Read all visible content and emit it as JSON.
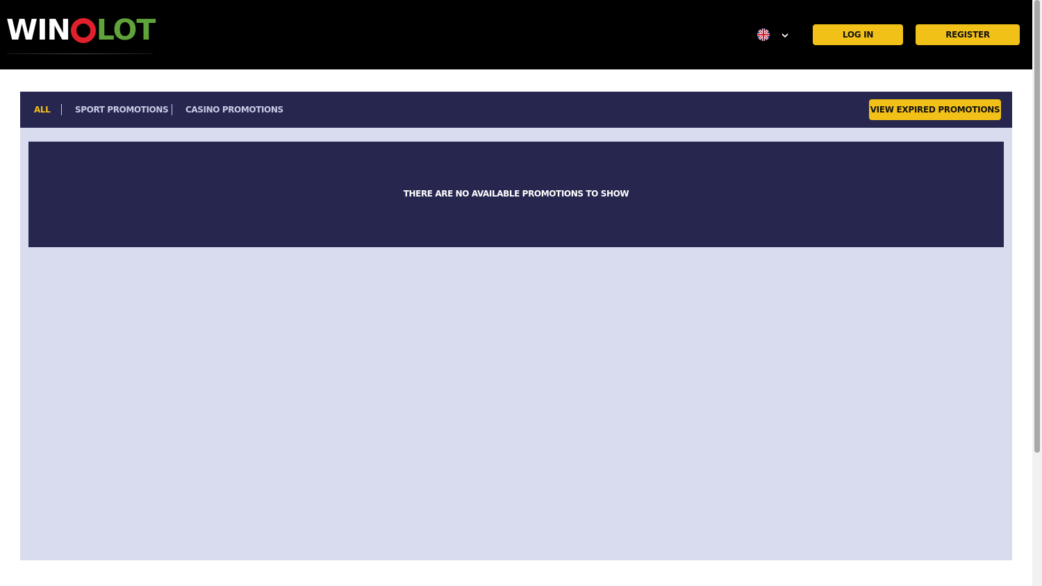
{
  "header": {
    "logo": {
      "part1": "WIN",
      "part2": "LOT"
    },
    "language": {
      "selected": "English",
      "flag_icon": "uk-flag-icon",
      "chevron_icon": "chevron-down-icon"
    },
    "login_label": "LOG IN",
    "register_label": "REGISTER"
  },
  "promotions": {
    "tabs": [
      {
        "label": "ALL",
        "active": true
      },
      {
        "label": "SPORT PROMOTIONS",
        "active": false
      },
      {
        "label": "CASINO PROMOTIONS",
        "active": false
      }
    ],
    "expired_button_label": "VIEW EXPIRED PROMOTIONS",
    "empty_message": "THERE ARE NO AVAILABLE PROMOTIONS TO SHOW"
  },
  "colors": {
    "header_bg": "#000000",
    "accent_yellow": "#f2c118",
    "panel_navy": "#26264f",
    "panel_bg": "#d9dbef",
    "logo_red": "#e0202b",
    "logo_green": "#5fa33a"
  }
}
